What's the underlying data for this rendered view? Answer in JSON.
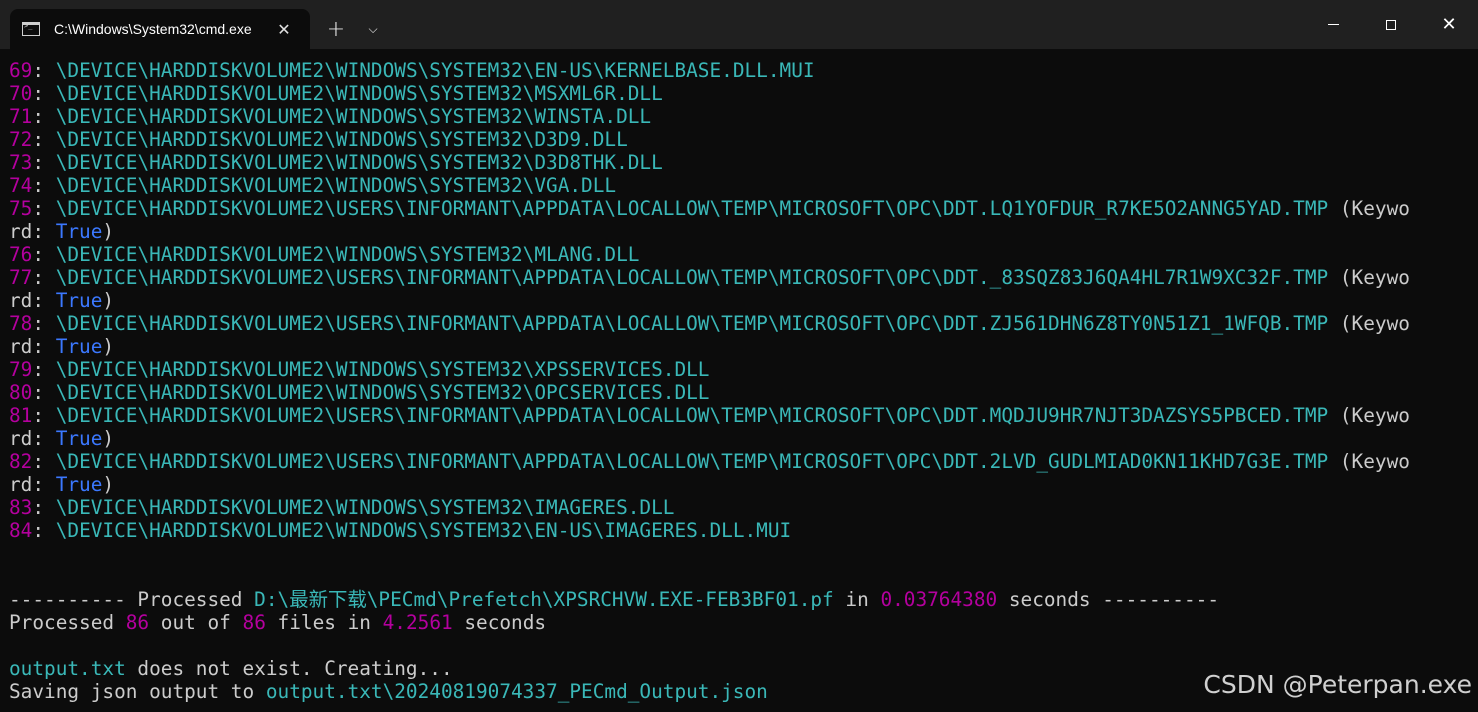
{
  "window": {
    "tab_title": "C:\\Windows\\System32\\cmd.exe",
    "tab_icon": "terminal-icon",
    "new_tab_label": "+",
    "dropdown_label": "⌵",
    "minimize_label": "",
    "maximize_label": "",
    "close_label": "✕",
    "tab_close_label": "✕"
  },
  "colors": {
    "background": "#0c0c0c",
    "titlebar": "#202020",
    "number": "#b4009e",
    "path": "#3ab8b8",
    "keyword_value": "#3b78ff",
    "text": "#cccccc"
  },
  "console": {
    "lines": [
      {
        "segments": [
          {
            "t": "69",
            "c": "num"
          },
          {
            "t": ": ",
            "c": "txt"
          },
          {
            "t": "\\DEVICE\\HARDDISKVOLUME2\\WINDOWS\\SYSTEM32\\EN-US\\KERNELBASE.DLL.MUI",
            "c": "path"
          }
        ]
      },
      {
        "segments": [
          {
            "t": "70",
            "c": "num"
          },
          {
            "t": ": ",
            "c": "txt"
          },
          {
            "t": "\\DEVICE\\HARDDISKVOLUME2\\WINDOWS\\SYSTEM32\\MSXML6R.DLL",
            "c": "path"
          }
        ]
      },
      {
        "segments": [
          {
            "t": "71",
            "c": "num"
          },
          {
            "t": ": ",
            "c": "txt"
          },
          {
            "t": "\\DEVICE\\HARDDISKVOLUME2\\WINDOWS\\SYSTEM32\\WINSTA.DLL",
            "c": "path"
          }
        ]
      },
      {
        "segments": [
          {
            "t": "72",
            "c": "num"
          },
          {
            "t": ": ",
            "c": "txt"
          },
          {
            "t": "\\DEVICE\\HARDDISKVOLUME2\\WINDOWS\\SYSTEM32\\D3D9.DLL",
            "c": "path"
          }
        ]
      },
      {
        "segments": [
          {
            "t": "73",
            "c": "num"
          },
          {
            "t": ": ",
            "c": "txt"
          },
          {
            "t": "\\DEVICE\\HARDDISKVOLUME2\\WINDOWS\\SYSTEM32\\D3D8THK.DLL",
            "c": "path"
          }
        ]
      },
      {
        "segments": [
          {
            "t": "74",
            "c": "num"
          },
          {
            "t": ": ",
            "c": "txt"
          },
          {
            "t": "\\DEVICE\\HARDDISKVOLUME2\\WINDOWS\\SYSTEM32\\VGA.DLL",
            "c": "path"
          }
        ]
      },
      {
        "segments": [
          {
            "t": "75",
            "c": "num"
          },
          {
            "t": ": ",
            "c": "txt"
          },
          {
            "t": "\\DEVICE\\HARDDISKVOLUME2\\USERS\\INFORMANT\\APPDATA\\LOCALLOW\\TEMP\\MICROSOFT\\OPC\\DDT.LQ1YOFDUR_R7KE5O2ANNG5YAD.TMP",
            "c": "path"
          },
          {
            "t": " (Keywo",
            "c": "txt"
          }
        ]
      },
      {
        "segments": [
          {
            "t": "rd: ",
            "c": "txt"
          },
          {
            "t": "True",
            "c": "val"
          },
          {
            "t": ")",
            "c": "txt"
          }
        ]
      },
      {
        "segments": [
          {
            "t": "76",
            "c": "num"
          },
          {
            "t": ": ",
            "c": "txt"
          },
          {
            "t": "\\DEVICE\\HARDDISKVOLUME2\\WINDOWS\\SYSTEM32\\MLANG.DLL",
            "c": "path"
          }
        ]
      },
      {
        "segments": [
          {
            "t": "77",
            "c": "num"
          },
          {
            "t": ": ",
            "c": "txt"
          },
          {
            "t": "\\DEVICE\\HARDDISKVOLUME2\\USERS\\INFORMANT\\APPDATA\\LOCALLOW\\TEMP\\MICROSOFT\\OPC\\DDT._83SQZ83J6QA4HL7R1W9XC32F.TMP",
            "c": "path"
          },
          {
            "t": " (Keywo",
            "c": "txt"
          }
        ]
      },
      {
        "segments": [
          {
            "t": "rd: ",
            "c": "txt"
          },
          {
            "t": "True",
            "c": "val"
          },
          {
            "t": ")",
            "c": "txt"
          }
        ]
      },
      {
        "segments": [
          {
            "t": "78",
            "c": "num"
          },
          {
            "t": ": ",
            "c": "txt"
          },
          {
            "t": "\\DEVICE\\HARDDISKVOLUME2\\USERS\\INFORMANT\\APPDATA\\LOCALLOW\\TEMP\\MICROSOFT\\OPC\\DDT.ZJ561DHN6Z8TY0N51Z1_1WFQB.TMP",
            "c": "path"
          },
          {
            "t": " (Keywo",
            "c": "txt"
          }
        ]
      },
      {
        "segments": [
          {
            "t": "rd: ",
            "c": "txt"
          },
          {
            "t": "True",
            "c": "val"
          },
          {
            "t": ")",
            "c": "txt"
          }
        ]
      },
      {
        "segments": [
          {
            "t": "79",
            "c": "num"
          },
          {
            "t": ": ",
            "c": "txt"
          },
          {
            "t": "\\DEVICE\\HARDDISKVOLUME2\\WINDOWS\\SYSTEM32\\XPSSERVICES.DLL",
            "c": "path"
          }
        ]
      },
      {
        "segments": [
          {
            "t": "80",
            "c": "num"
          },
          {
            "t": ": ",
            "c": "txt"
          },
          {
            "t": "\\DEVICE\\HARDDISKVOLUME2\\WINDOWS\\SYSTEM32\\OPCSERVICES.DLL",
            "c": "path"
          }
        ]
      },
      {
        "segments": [
          {
            "t": "81",
            "c": "num"
          },
          {
            "t": ": ",
            "c": "txt"
          },
          {
            "t": "\\DEVICE\\HARDDISKVOLUME2\\USERS\\INFORMANT\\APPDATA\\LOCALLOW\\TEMP\\MICROSOFT\\OPC\\DDT.MQDJU9HR7NJT3DAZSYS5PBCED.TMP",
            "c": "path"
          },
          {
            "t": " (Keywo",
            "c": "txt"
          }
        ]
      },
      {
        "segments": [
          {
            "t": "rd: ",
            "c": "txt"
          },
          {
            "t": "True",
            "c": "val"
          },
          {
            "t": ")",
            "c": "txt"
          }
        ]
      },
      {
        "segments": [
          {
            "t": "82",
            "c": "num"
          },
          {
            "t": ": ",
            "c": "txt"
          },
          {
            "t": "\\DEVICE\\HARDDISKVOLUME2\\USERS\\INFORMANT\\APPDATA\\LOCALLOW\\TEMP\\MICROSOFT\\OPC\\DDT.2LVD_GUDLMIAD0KN11KHD7G3E.TMP",
            "c": "path"
          },
          {
            "t": " (Keywo",
            "c": "txt"
          }
        ]
      },
      {
        "segments": [
          {
            "t": "rd: ",
            "c": "txt"
          },
          {
            "t": "True",
            "c": "val"
          },
          {
            "t": ")",
            "c": "txt"
          }
        ]
      },
      {
        "segments": [
          {
            "t": "83",
            "c": "num"
          },
          {
            "t": ": ",
            "c": "txt"
          },
          {
            "t": "\\DEVICE\\HARDDISKVOLUME2\\WINDOWS\\SYSTEM32\\IMAGERES.DLL",
            "c": "path"
          }
        ]
      },
      {
        "segments": [
          {
            "t": "84",
            "c": "num"
          },
          {
            "t": ": ",
            "c": "txt"
          },
          {
            "t": "\\DEVICE\\HARDDISKVOLUME2\\WINDOWS\\SYSTEM32\\EN-US\\IMAGERES.DLL.MUI",
            "c": "path"
          }
        ]
      },
      {
        "segments": []
      },
      {
        "segments": []
      },
      {
        "segments": [
          {
            "t": "---------- Processed ",
            "c": "txt"
          },
          {
            "t": "D:\\最新下载\\PECmd\\Prefetch\\XPSRCHVW.EXE-FEB3BF01.pf",
            "c": "path"
          },
          {
            "t": " in ",
            "c": "txt"
          },
          {
            "t": "0.03764380",
            "c": "num"
          },
          {
            "t": " seconds ----------",
            "c": "txt"
          }
        ]
      },
      {
        "segments": [
          {
            "t": "Processed ",
            "c": "txt"
          },
          {
            "t": "86",
            "c": "num"
          },
          {
            "t": " out of ",
            "c": "txt"
          },
          {
            "t": "86",
            "c": "num"
          },
          {
            "t": " files in ",
            "c": "txt"
          },
          {
            "t": "4.2561",
            "c": "num"
          },
          {
            "t": " seconds",
            "c": "txt"
          }
        ]
      },
      {
        "segments": []
      },
      {
        "segments": [
          {
            "t": "output.txt",
            "c": "path"
          },
          {
            "t": " does not exist. Creating...",
            "c": "txt"
          }
        ]
      },
      {
        "segments": [
          {
            "t": "Saving json output to ",
            "c": "txt"
          },
          {
            "t": "output.txt\\20240819074337_PECmd_Output.json",
            "c": "path"
          }
        ]
      }
    ]
  },
  "watermark": "CSDN @Peterpan.exe"
}
